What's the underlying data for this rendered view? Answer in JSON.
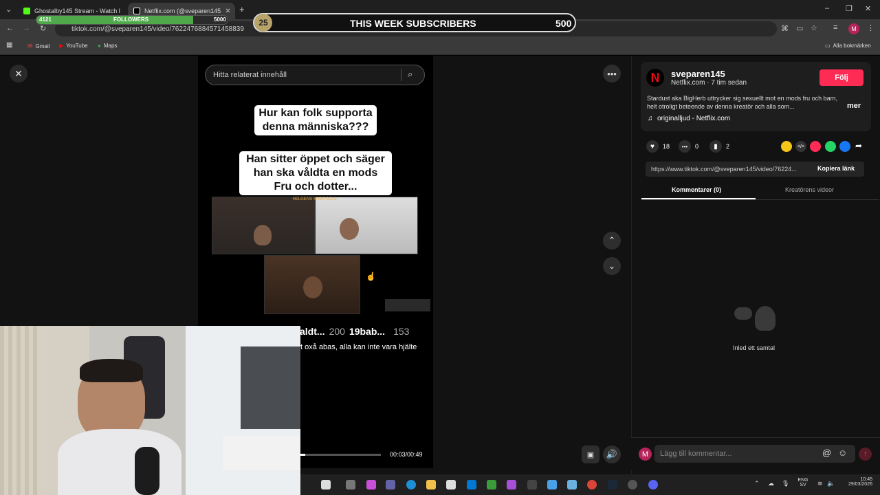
{
  "browser": {
    "tabs": [
      {
        "title": "Ghostalby145 Stream - Watch l",
        "active": false
      },
      {
        "title": "Netflix.com (@sveparen145",
        "active": true
      }
    ],
    "url": "tiktok.com/@sveparen145/video/7622476884571458839",
    "bookmarks": [
      "Gmail",
      "YouTube",
      "Maps"
    ],
    "all_bookmarks": "Alla bokmärken",
    "profile_initial": "M"
  },
  "overlay": {
    "followers_current": "4121",
    "followers_label": "FOLLOWERS",
    "followers_goal": "5000",
    "followers_progress": 0.82,
    "subs_badge": "25",
    "subs_label": "THIS WEEK SUBSCRIBERS",
    "subs_goal": "500"
  },
  "video": {
    "search_placeholder": "Hitta relaterat innehåll",
    "caption1": "Hur kan folk supporta denna människa???",
    "caption2": "Han sitter öppet och säger han ska våldta en mods Fru och dotter...",
    "stream_banner": "HELGENS SUBS GOAL",
    "chat_line1_part1": "aldt...",
    "chat_line1_count1": "200",
    "chat_line1_user": "19bab...",
    "chat_line1_count2": "153",
    "chat_line2": "t oxå abas, alla kan inte vara hjälte",
    "time": "00:03/00:49",
    "progress": 0.06
  },
  "profile": {
    "username": "sveparen145",
    "meta": "Netflix.com · 7 tim sedan",
    "follow_label": "Följ",
    "description": "Stardust aka BigHerb uttrycker sig sexuellt mot en mods fru och barn, helt otroligt beteende av denna kreatör och alla som...",
    "more_label": "mer",
    "sound": "originalljud - Netflix.com"
  },
  "actions": {
    "likes": "18",
    "comments": "0",
    "saves": "2"
  },
  "share": {
    "link": "https://www.tiktok.com/@sveparen145/video/76224...",
    "copy_label": "Kopiera länk"
  },
  "tabs": {
    "comments": "Kommentarer (0)",
    "creator_videos": "Kreatörens videor"
  },
  "empty": {
    "text": "Inled ett samtal"
  },
  "comment": {
    "placeholder": "Lägg till kommentar...",
    "avatar": "M"
  },
  "taskbar": {
    "lang": "ENG",
    "lang_sub": "SV",
    "time": "10:45",
    "date": "29/03/2026"
  },
  "colors": {
    "accent": "#fe2c55",
    "followers_bar": "#4fa84a"
  }
}
